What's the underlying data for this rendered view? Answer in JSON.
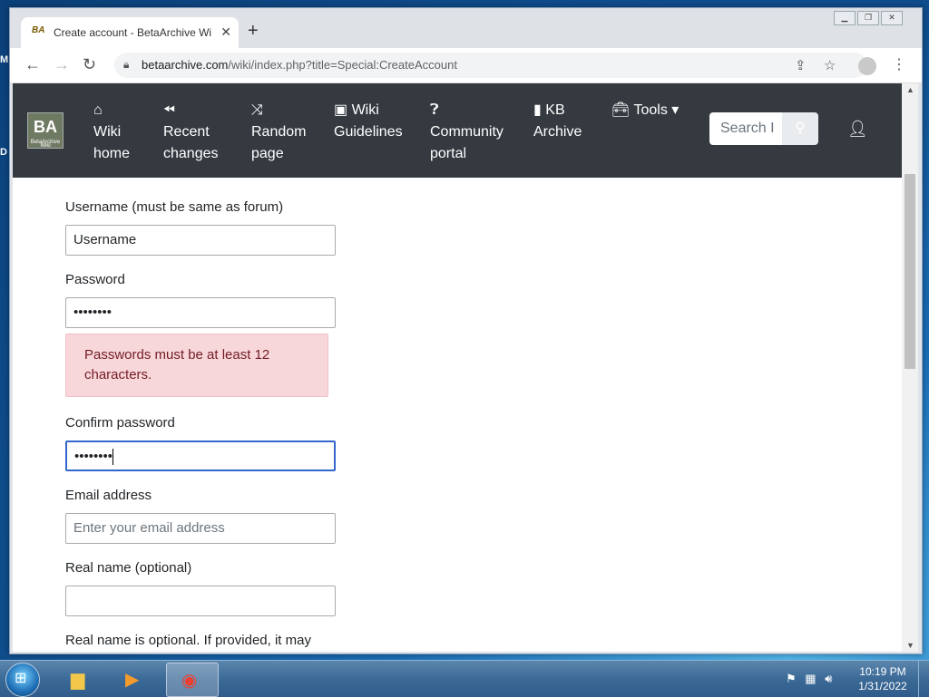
{
  "tab": {
    "title": "Create account - BetaArchive Wi",
    "favicon": "BA"
  },
  "address": {
    "host": "betaarchive.com",
    "path": "/wiki/index.php?title=Special:CreateAccount"
  },
  "navbar": {
    "logo": "BA",
    "logo_sub": "BetaArchive Wiki",
    "items": [
      {
        "icon": "home-icon",
        "line1": "Wiki",
        "line2": "home"
      },
      {
        "icon": "rewind-icon",
        "line1": "Recent",
        "line2": "changes"
      },
      {
        "icon": "shuffle-icon",
        "line1": "Random",
        "line2": "page"
      },
      {
        "icon": "book-icon",
        "line1": "Wiki",
        "line2": "Guidelines"
      },
      {
        "icon": "question-icon",
        "line1": "Community",
        "line2": "portal"
      },
      {
        "icon": "book-open-icon",
        "line1": "KB",
        "line2": "Archive"
      }
    ],
    "tools_label": "Tools",
    "search_placeholder": "Search I"
  },
  "form": {
    "username_label": "Username (must be same as forum)",
    "username_value": "Username",
    "password_label": "Password",
    "password_value": "••••••••",
    "password_error": "Passwords must be at least 12 characters.",
    "confirm_label": "Confirm password",
    "confirm_value": "••••••••",
    "email_label": "Email address",
    "email_placeholder": "Enter your email address",
    "realname_label": "Real name (optional)",
    "realname_value": "",
    "realname_help": "Real name is optional. If provided, it may"
  },
  "taskbar": {
    "time": "10:19 PM",
    "date": "1/31/2022"
  },
  "desktop": {
    "edge_letters": [
      "M",
      "D"
    ]
  }
}
